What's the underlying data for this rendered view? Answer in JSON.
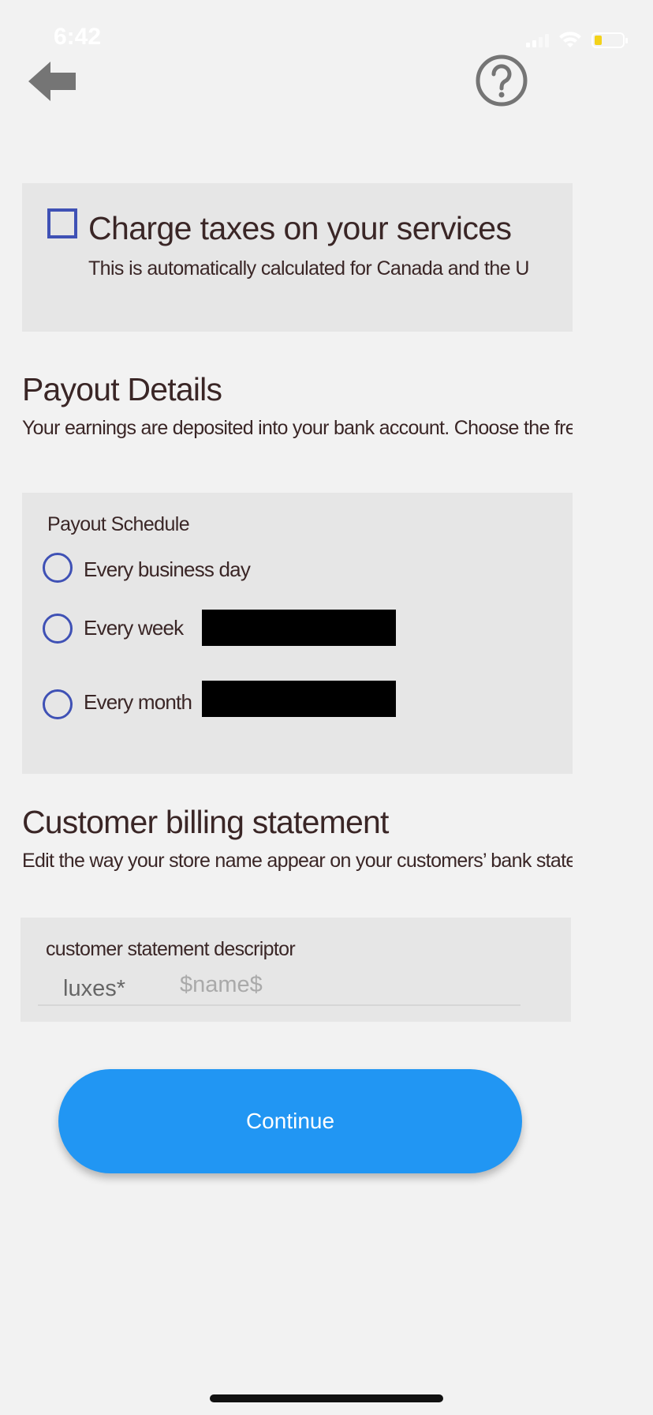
{
  "status_bar": {
    "time": "6:42"
  },
  "header": {
    "back_icon": "back-arrow-icon",
    "help_icon": "help-circle-icon"
  },
  "tax": {
    "title": "Charge taxes on your services",
    "subtitle": "This is automatically calculated for Canada and the Ur",
    "checked": false
  },
  "payout": {
    "title": "Payout Details",
    "subtitle": "Your earnings are deposited into your bank account. Choose the fre",
    "schedule_label": "Payout Schedule",
    "options": [
      {
        "label": "Every business day"
      },
      {
        "label": "Every week"
      },
      {
        "label": "Every month"
      }
    ]
  },
  "billing": {
    "title": "Customer billing statement",
    "subtitle": "Edit the way your store name appear on your customers’ bank state",
    "descriptor_label": "customer statement descriptor",
    "descriptor_prefix": "luxes*",
    "descriptor_placeholder": "$name$",
    "descriptor_value": ""
  },
  "actions": {
    "continue_label": "Continue"
  },
  "colors": {
    "accent": "#3f51b5",
    "button": "#2196f3",
    "background": "#f2f2f2",
    "panel": "#e6e6e6",
    "text": "#3a2626",
    "battery": "#f3d21a"
  }
}
